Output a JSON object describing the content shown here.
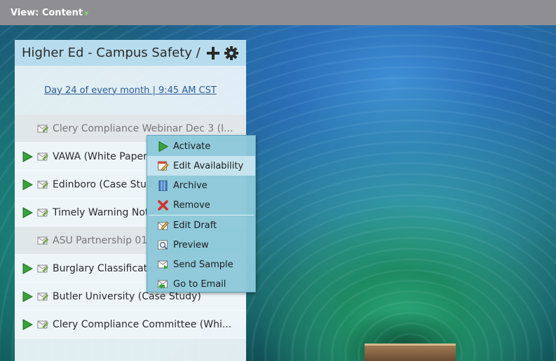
{
  "topbar": {
    "view_label": "View: Content"
  },
  "panel": {
    "title": "Higher Ed - Campus Safety / ...",
    "schedule_link": "Day 24 of every month | 9:45 AM CST",
    "emails": [
      {
        "name": "Clery Compliance Webinar Dec 3 (I...",
        "active": false
      },
      {
        "name": "VAWA (White Paper)",
        "active": true
      },
      {
        "name": "Edinboro (Case Study)",
        "active": true
      },
      {
        "name": "Timely Warning Notic",
        "active": true
      },
      {
        "name": "ASU Partnership 01",
        "active": false
      },
      {
        "name": "Burglary Classificatio",
        "active": true
      },
      {
        "name": "Butler University (Case Study)",
        "active": true
      },
      {
        "name": "Clery Compliance Committee (Whi...",
        "active": true
      }
    ]
  },
  "context_menu": {
    "items": [
      {
        "label": "Activate",
        "icon": "activate-icon"
      },
      {
        "label": "Edit Availability",
        "icon": "edit-availability-icon"
      },
      {
        "label": "Archive",
        "icon": "archive-icon"
      },
      {
        "label": "Remove",
        "icon": "remove-icon"
      },
      {
        "label": "Edit Draft",
        "icon": "edit-draft-icon"
      },
      {
        "label": "Preview",
        "icon": "preview-icon"
      },
      {
        "label": "Send Sample",
        "icon": "send-sample-icon"
      },
      {
        "label": "Go to Email",
        "icon": "go-to-email-icon"
      }
    ]
  },
  "colors": {
    "topbar": "#8e8e93",
    "panel_header": "#b7dcee",
    "menu_bg": "#8cc8da",
    "link": "#2a5d96",
    "play_green": "#3aa43a"
  }
}
